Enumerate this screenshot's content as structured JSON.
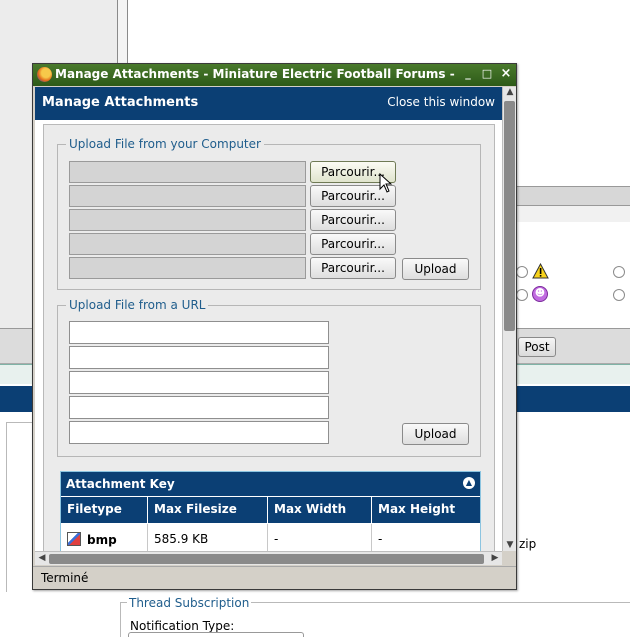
{
  "background": {
    "post_button": "Post",
    "zip_text": "zip",
    "thread_subscription_legend": "Thread Subscription",
    "notification_type_label": "Notification Type:"
  },
  "window": {
    "title": "Manage Attachments - Miniature Electric Football Forums - Mozilla Firefox",
    "minimize": "_",
    "maximize": "□",
    "close": "×"
  },
  "header": {
    "title": "Manage Attachments",
    "close_link": "Close this window"
  },
  "upload_computer": {
    "legend": "Upload File from your Computer",
    "browse_label": "Parcourir...",
    "upload_label": "Upload",
    "file_fields": [
      "",
      "",
      "",
      "",
      ""
    ]
  },
  "upload_url": {
    "legend": "Upload File from a URL",
    "upload_label": "Upload",
    "url_fields": [
      "",
      "",
      "",
      "",
      ""
    ]
  },
  "attachment_key": {
    "title": "Attachment Key",
    "columns": [
      "Filetype",
      "Max Filesize",
      "Max Width",
      "Max Height"
    ],
    "rows": [
      {
        "filetype": "bmp",
        "max_filesize": "585.9 KB",
        "max_width": "-",
        "max_height": "-"
      }
    ]
  },
  "status": {
    "text": "Terminé"
  },
  "colors": {
    "navy": "#0b3f74",
    "legend_blue": "#1f5d8c",
    "titlebar_green": "#3a6a22"
  }
}
